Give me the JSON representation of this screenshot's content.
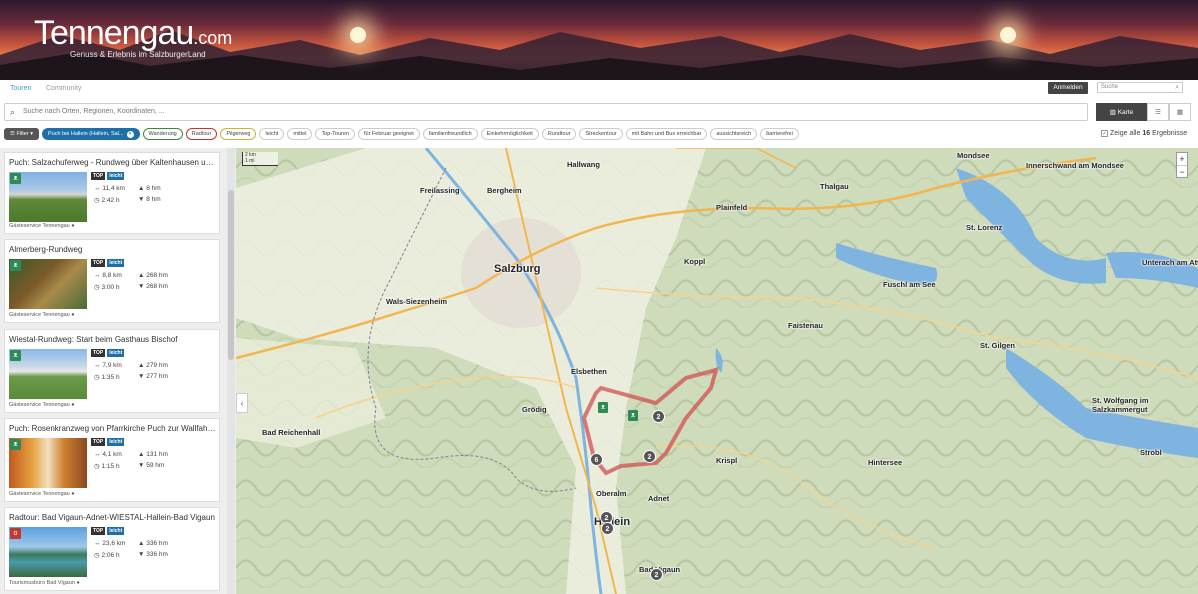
{
  "header": {
    "logo_name": "Tennengau",
    "logo_suffix": ".com",
    "logo_tagline": "Genuss & Erlebnis im SalzburgerLand"
  },
  "nav": {
    "tabs": [
      "Touren",
      "Community"
    ],
    "login_label": "Anmelden",
    "search_placeholder": "Suche"
  },
  "search": {
    "placeholder": "Suche nach Orten, Regionen, Koordinaten, ..."
  },
  "view_toggle": {
    "map_label": "Karte",
    "list_icon": "list-icon",
    "grid_icon": "grid-icon"
  },
  "filters": {
    "filter_label": "Filter",
    "place": "Puch bei Hallein (Hallein, Sal...",
    "chips": [
      "Wanderung",
      "Radtour",
      "Pilgerweg",
      "leicht",
      "mittel",
      "Top-Touren",
      "für Februar geeignet",
      "familienfreundlich",
      "Einkehrmöglichkeit",
      "Rundtour",
      "Streckentour",
      "mit Bahn und Bus erreichbar",
      "aussichtsreich",
      "barrierefrei"
    ],
    "show_all_prefix": "Zeige alle",
    "show_all_count": "16",
    "show_all_suffix": "Ergebnisse"
  },
  "tours": [
    {
      "title": "Puch: Salzachuferweg - Rundweg über Kaltenhausen und ...",
      "top": "TOP",
      "difficulty": "leicht",
      "distance": "11,4 km",
      "duration": "2:42 h",
      "ascent": "8 hm",
      "descent": "8 hm",
      "source": "Gästeservice Tennengau",
      "category": "hike"
    },
    {
      "title": "Almerberg-Rundweg",
      "top": "TOP",
      "difficulty": "leicht",
      "distance": "8,8 km",
      "duration": "3:00 h",
      "ascent": "268 hm",
      "descent": "268 hm",
      "source": "Gästeservice Tennengau",
      "category": "hike"
    },
    {
      "title": "Wiestal-Rundweg: Start beim Gasthaus Bischof",
      "top": "TOP",
      "difficulty": "leicht",
      "distance": "7,9 km",
      "duration": "1:35 h",
      "ascent": "279 hm",
      "descent": "277 hm",
      "source": "Gästeservice Tennengau",
      "category": "hike"
    },
    {
      "title": "Puch: Rosenkranzweg von Pfarrkirche Puch zur Wallfahrts...",
      "top": "TOP",
      "difficulty": "leicht",
      "distance": "4,1 km",
      "duration": "1:15 h",
      "ascent": "131 hm",
      "descent": "59 hm",
      "source": "Gästeservice Tennengau",
      "category": "hike"
    },
    {
      "title": "Radtour: Bad Vigaun-Adnet-WIESTAL-Hallein-Bad Vigaun",
      "top": "TOP",
      "difficulty": "leicht",
      "distance": "23,6 km",
      "duration": "2:06 h",
      "ascent": "336 hm",
      "descent": "336 hm",
      "source": "Tourismusbüro Bad Vigaun",
      "category": "bike"
    }
  ],
  "map": {
    "scale_top": "2 km",
    "scale_bottom": "1 mi",
    "zoom_in": "+",
    "zoom_out": "−",
    "places": [
      {
        "name": "Hallwang"
      },
      {
        "name": "Freilassing"
      },
      {
        "name": "Bergheim"
      },
      {
        "name": "Salzburg"
      },
      {
        "name": "Plainfeld"
      },
      {
        "name": "Thalgau"
      },
      {
        "name": "Mondsee"
      },
      {
        "name": "Innerschwand am Mondsee"
      },
      {
        "name": "St. Lorenz"
      },
      {
        "name": "Koppl"
      },
      {
        "name": "Wals-Siezenheim"
      },
      {
        "name": "Fuschl am See"
      },
      {
        "name": "Unterach am Atte"
      },
      {
        "name": "Faistenau"
      },
      {
        "name": "Elsbethen"
      },
      {
        "name": "St. Gilgen"
      },
      {
        "name": "Grödig"
      },
      {
        "name": "Bad Reichenhall"
      },
      {
        "name": "St. Wolfgang im Salzkammergut"
      },
      {
        "name": "Krispl"
      },
      {
        "name": "Hintersee"
      },
      {
        "name": "Strobl"
      },
      {
        "name": "Oberalm"
      },
      {
        "name": "Adnet"
      },
      {
        "name": "Hallein"
      },
      {
        "name": "Bad Vigaun"
      }
    ],
    "clusters": [
      "2",
      "2",
      "6",
      "2",
      "2",
      "2"
    ],
    "colors": {
      "route": "#d05050",
      "water": "#7fb4e0",
      "road": "#f2b64f"
    }
  }
}
